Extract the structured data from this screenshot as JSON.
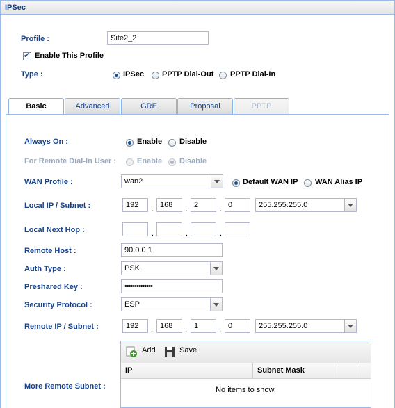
{
  "window": {
    "title": "IPSec"
  },
  "profile": {
    "label": "Profile :",
    "value": "Site2_2"
  },
  "enable_profile": {
    "label": "Enable This Profile",
    "checked": true
  },
  "type": {
    "label": "Type :",
    "options": [
      "IPSec",
      "PPTP Dial-Out",
      "PPTP Dial-In"
    ],
    "selected": "IPSec"
  },
  "tabs": [
    "Basic",
    "Advanced",
    "GRE",
    "Proposal",
    "PPTP"
  ],
  "active_tab": "Basic",
  "always_on": {
    "label": "Always On :",
    "options": [
      "Enable",
      "Disable"
    ],
    "selected": "Enable"
  },
  "remote_dialin": {
    "label": "For Remote Dial-In User :",
    "options": [
      "Enable",
      "Disable"
    ],
    "selected": "Disable",
    "disabled": true
  },
  "wan_profile": {
    "label": "WAN Profile :",
    "value": "wan2",
    "ip_options": [
      "Default WAN IP",
      "WAN Alias IP"
    ],
    "ip_selected": "Default WAN IP"
  },
  "local_ip": {
    "label": "Local IP / Subnet :",
    "octets": [
      "192",
      "168",
      "2",
      "0"
    ],
    "mask": "255.255.255.0"
  },
  "local_next_hop": {
    "label": "Local Next Hop :",
    "octets": [
      "",
      "",
      "",
      ""
    ]
  },
  "remote_host": {
    "label": "Remote Host :",
    "value": "90.0.0.1"
  },
  "auth_type": {
    "label": "Auth Type :",
    "value": "PSK"
  },
  "preshared_key": {
    "label": "Preshared Key :",
    "value": "••••••••••••••"
  },
  "security_protocol": {
    "label": "Security Protocol :",
    "value": "ESP"
  },
  "remote_ip": {
    "label": "Remote IP / Subnet :",
    "octets": [
      "192",
      "168",
      "1",
      "0"
    ],
    "mask": "255.255.255.0"
  },
  "more_remote_subnet": {
    "label": "More Remote Subnet :",
    "toolbar": {
      "add": "Add",
      "save": "Save"
    },
    "columns": [
      "IP",
      "Subnet Mask"
    ],
    "empty_text": "No items to show."
  },
  "colors": {
    "label": "#15428b",
    "border": "#99bbe8"
  }
}
